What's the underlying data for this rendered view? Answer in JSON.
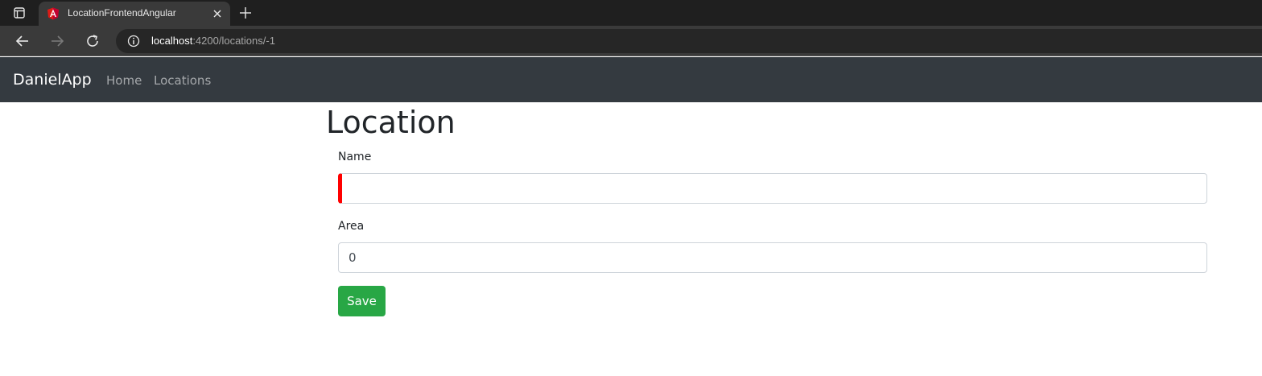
{
  "browser": {
    "tab": {
      "title": "LocationFrontendAngular",
      "favicon_icon": "angular-icon",
      "close_icon": "close-icon"
    },
    "new_tab_icon": "plus-icon",
    "address_bar": {
      "host": "localhost",
      "rest": ":4200/locations/-1",
      "info_icon": "info-icon"
    },
    "nav_icons": [
      "back-arrow-icon",
      "forward-arrow-icon",
      "reload-icon"
    ]
  },
  "navbar": {
    "brand": "DanielApp",
    "links": [
      {
        "label": "Home"
      },
      {
        "label": "Locations"
      }
    ],
    "background": "#343a40"
  },
  "form": {
    "title": "Location",
    "name_label": "Name",
    "name_value": "",
    "area_label": "Area",
    "area_value": "0",
    "save_label": "Save"
  },
  "colors": {
    "save_button": "#28a745",
    "invalid_indicator": "#ff0000",
    "accent_tab": "#3a3a3a"
  }
}
